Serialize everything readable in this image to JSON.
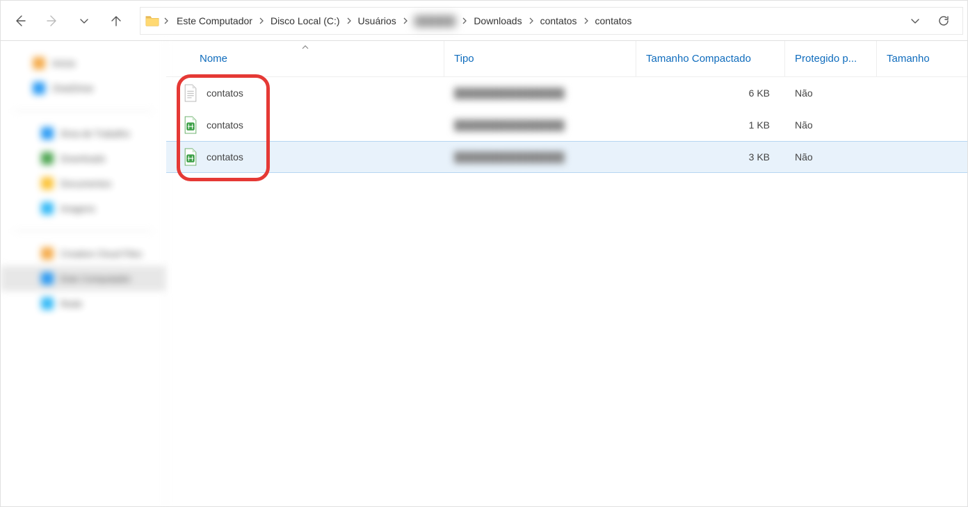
{
  "breadcrumbs": [
    "Este Computador",
    "Disco Local (C:)",
    "Usuários",
    "",
    "Downloads",
    "contatos",
    "contatos"
  ],
  "breadcrumb_blurred_index": 3,
  "columns": {
    "name": "Nome",
    "type": "Tipo",
    "compressed_size": "Tamanho Compactado",
    "protected": "Protegido p...",
    "size": "Tamanho"
  },
  "files": [
    {
      "name": "contatos",
      "icon": "generic",
      "compressed_size": "6 KB",
      "protected": "Não"
    },
    {
      "name": "contatos",
      "icon": "spread",
      "compressed_size": "1 KB",
      "protected": "Não"
    },
    {
      "name": "contatos",
      "icon": "spread",
      "compressed_size": "3 KB",
      "protected": "Não",
      "selected": true
    }
  ],
  "sidebar": {
    "groups": [
      [
        {
          "label": "Início",
          "color": "c-orange"
        },
        {
          "label": "OneDrive",
          "color": "c-blue"
        }
      ],
      [
        {
          "label": "Área de Trabalho",
          "color": "c-blue",
          "indent": true
        },
        {
          "label": "Downloads",
          "color": "c-green",
          "indent": true
        },
        {
          "label": "Documentos",
          "color": "c-yellow",
          "indent": true
        },
        {
          "label": "Imagens",
          "color": "c-cyan",
          "indent": true
        }
      ],
      [
        {
          "label": "Creative Cloud Files",
          "color": "c-orange",
          "indent": true
        },
        {
          "label": "Este Computador",
          "color": "c-blue",
          "indent": true,
          "selected": true
        },
        {
          "label": "Rede",
          "color": "c-cyan",
          "indent": true
        }
      ]
    ]
  }
}
